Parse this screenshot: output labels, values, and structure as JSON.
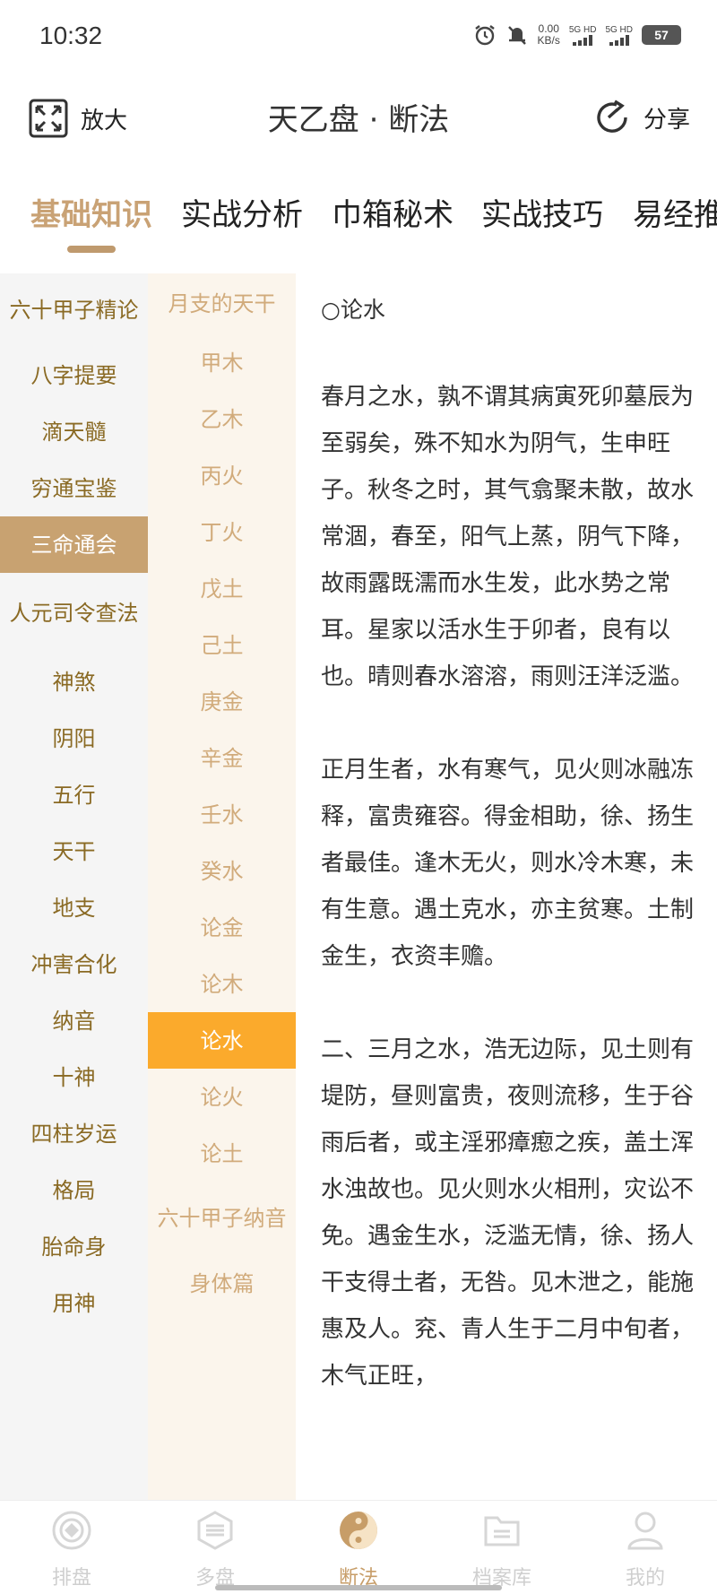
{
  "status_bar": {
    "time": "10:32",
    "speed_value": "0.00",
    "speed_unit": "KB/s",
    "sim1": "5G HD",
    "sim2": "5G HD",
    "battery": "57"
  },
  "header": {
    "left_label": "放大",
    "title": "天乙盘 · 断法",
    "right_label": "分享"
  },
  "category_tabs": [
    {
      "label": "基础知识",
      "active": true
    },
    {
      "label": "实战分析"
    },
    {
      "label": "巾箱秘术"
    },
    {
      "label": "实战技巧"
    },
    {
      "label": "易经推"
    }
  ],
  "left_menu": [
    "六十甲子精论",
    "八字提要",
    "滴天髓",
    "穷通宝鉴",
    "三命通会",
    "人元司令查法",
    "神煞",
    "阴阳",
    "五行",
    "天干",
    "地支",
    "冲害合化",
    "纳音",
    "十神",
    "四柱岁运",
    "格局",
    "胎命身",
    "用神"
  ],
  "left_menu_active": "三命通会",
  "mid_menu": [
    "月支的天干",
    "甲木",
    "乙木",
    "丙火",
    "丁火",
    "戊土",
    "己土",
    "庚金",
    "辛金",
    "壬水",
    "癸水",
    "论金",
    "论木",
    "论水",
    "论火",
    "论土",
    "六十甲子纳音",
    "身体篇"
  ],
  "mid_menu_active": "论水",
  "content": {
    "title": "○论水",
    "paragraphs": [
      "春月之水，孰不谓其病寅死卯墓辰为至弱矣，殊不知水为阴气，生申旺子。秋冬之时，其气翕聚未散，故水常涸，春至，阳气上蒸，阴气下降，故雨露既濡而水生发，此水势之常耳。星家以活水生于卯者，良有以也。晴则春水溶溶，雨则汪洋泛滥。",
      "正月生者，水有寒气，见火则冰融冻释，富贵雍容。得金相助，徐、扬生者最佳。逢木无火，则水冷木寒，未有生意。遇土克水，亦主贫寒。土制金生，衣资丰赡。",
      "二、三月之水，浩无边际，见土则有堤防，昼则富贵，夜则流移，生于谷雨后者，或主淫邪瘴瘛之疾，盖土浑水浊故也。见火则水火相刑，灾讼不免。遇金生水，泛滥无情，徐、扬人干支得土者，无咎。见木泄之，能施惠及人。兖、青人生于二月中旬者，木气正旺，"
    ]
  },
  "bottom_nav": [
    {
      "label": "排盘",
      "icon": "paipan-icon"
    },
    {
      "label": "多盘",
      "icon": "duopan-icon"
    },
    {
      "label": "断法",
      "icon": "yinyang-icon",
      "active": true
    },
    {
      "label": "档案库",
      "icon": "archive-icon"
    },
    {
      "label": "我的",
      "icon": "user-icon"
    }
  ],
  "colors": {
    "accent_gold": "#c8a271",
    "active_orange": "#fbaa2c",
    "left_text": "#8a6a24",
    "mid_text": "#d1ab7b"
  }
}
